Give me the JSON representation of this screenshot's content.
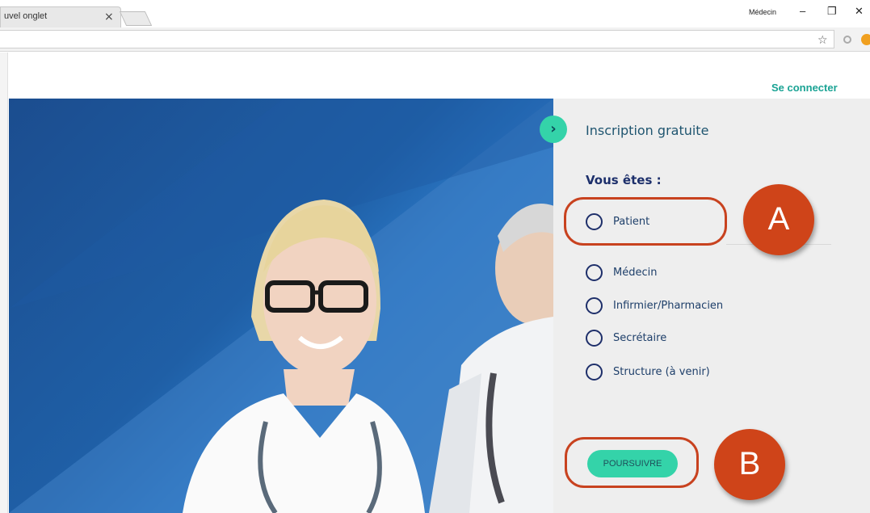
{
  "browser": {
    "tab_title": "uvel onglet",
    "tab_close": "×",
    "profile_name": "Médecin",
    "window_controls": {
      "minimize": "–",
      "restore": "❐",
      "close": "✕"
    },
    "star": "☆",
    "icons": [
      "star-icon",
      "extension-icon",
      "notification-icon"
    ]
  },
  "header": {
    "login_label": "Se connecter"
  },
  "panel": {
    "toggle_glyph": "›",
    "title": "Inscription gratuite",
    "question": "Vous êtes :",
    "options": [
      {
        "label": "Patient"
      },
      {
        "label": "Médecin"
      },
      {
        "label": "Infirmier/Pharmacien"
      },
      {
        "label": "Secrétaire"
      },
      {
        "label": "Structure (à venir)"
      }
    ],
    "continue_label": "POURSUIVRE"
  },
  "annotations": {
    "a": "A",
    "b": "B"
  },
  "colors": {
    "accent": "#34d3a9",
    "link": "#1aa394",
    "navy": "#1c2f6b",
    "annotation": "#cf4419"
  }
}
